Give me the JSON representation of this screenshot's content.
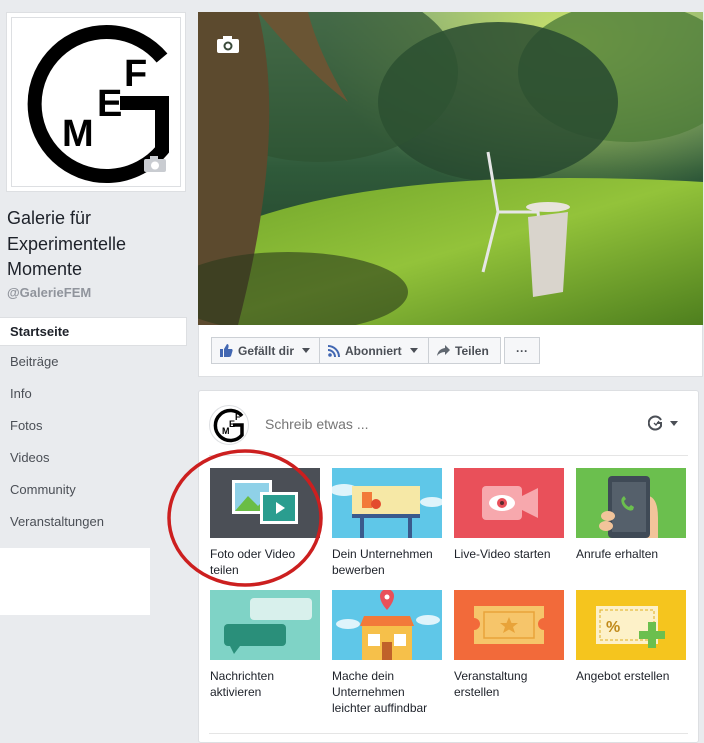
{
  "page": {
    "name": "Galerie für Experimentelle Momente",
    "handle": "@GalerieFEM",
    "logo_letters": "GMEF"
  },
  "nav": {
    "items": [
      {
        "label": "Startseite",
        "active": true
      },
      {
        "label": "Beiträge"
      },
      {
        "label": "Info"
      },
      {
        "label": "Fotos"
      },
      {
        "label": "Videos"
      },
      {
        "label": "Community"
      },
      {
        "label": "Veranstaltungen"
      }
    ]
  },
  "actions": {
    "like_label": "Gefällt dir",
    "follow_label": "Abonniert",
    "share_label": "Teilen",
    "more_label": "···"
  },
  "composer": {
    "placeholder": "Schreib etwas ..."
  },
  "tiles": [
    {
      "label": "Foto oder Video teilen",
      "icon": "photo-video-icon",
      "color": "#4b4f56"
    },
    {
      "label": "Dein Unternehmen bewerben",
      "icon": "billboard-icon",
      "color": "#5fc7e8"
    },
    {
      "label": "Live-Video starten",
      "icon": "live-video-icon",
      "color": "#e9505a"
    },
    {
      "label": "Anrufe erhalten",
      "icon": "phone-call-icon",
      "color": "#6bbf4e"
    },
    {
      "label": "Nachrichten aktivieren",
      "icon": "chat-bubbles-icon",
      "color": "#7fd3c6"
    },
    {
      "label": "Mache dein Unternehmen leichter auffindbar",
      "icon": "store-location-icon",
      "color": "#5fc7e8"
    },
    {
      "label": "Veranstaltung erstellen",
      "icon": "ticket-icon",
      "color": "#f26a3a"
    },
    {
      "label": "Angebot erstellen",
      "icon": "coupon-icon",
      "color": "#f5c51e"
    }
  ],
  "colors": {
    "annotation_circle": "#cc1f1f",
    "fb_blue": "#4267b2"
  }
}
